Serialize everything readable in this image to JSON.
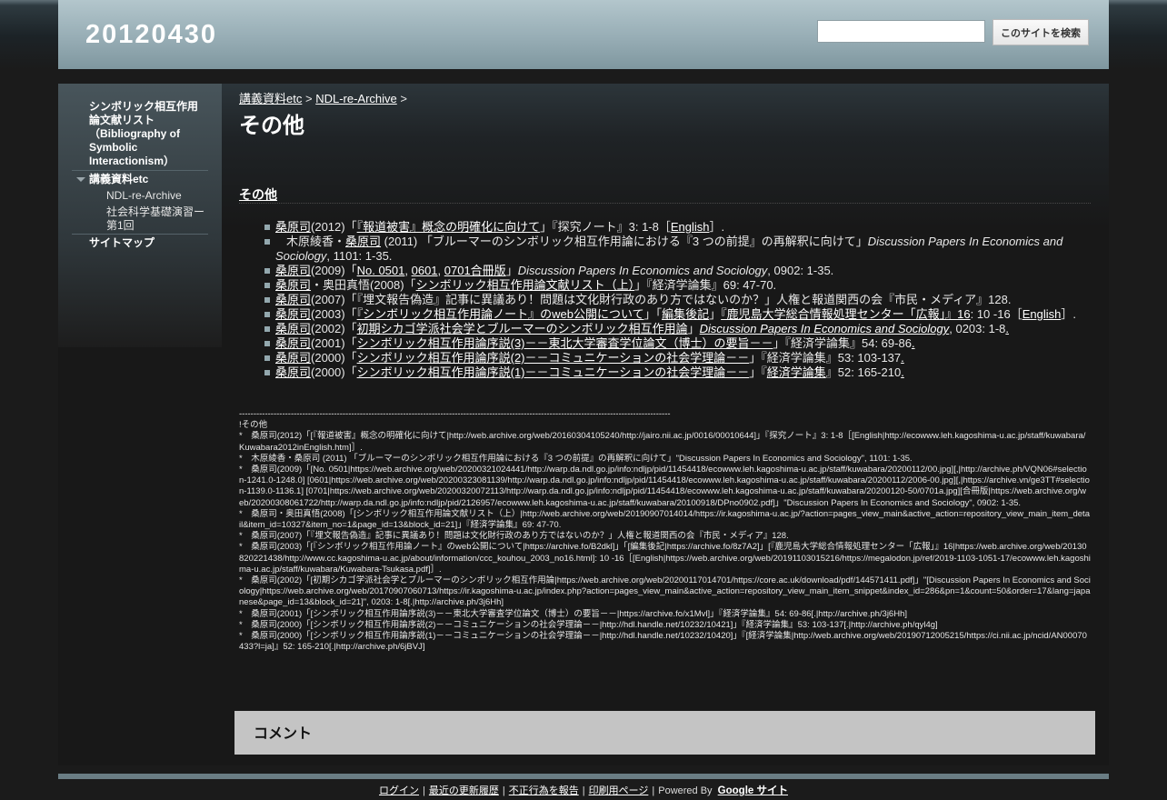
{
  "site": {
    "title": "20120430"
  },
  "search": {
    "placeholder": "",
    "button_label": "このサイトを検索"
  },
  "sidebar": {
    "items": [
      {
        "label": "シンボリック相互作用論文献リスト（Bibliography of Symbolic Interactionism）"
      },
      {
        "label": "講義資料etc",
        "expanded": true,
        "children": [
          {
            "label": "NDL-re-Archive"
          },
          {
            "label": "社会科学基礎演習ー第1回"
          }
        ]
      },
      {
        "label": "サイトマップ"
      }
    ]
  },
  "breadcrumb": {
    "items": [
      "講義資料etc",
      "NDL-re-Archive"
    ],
    "sep": ">"
  },
  "page": {
    "title": "その他",
    "section_heading": "その他"
  },
  "refs": {
    "r1": {
      "a1": "桑原司",
      "t1": "(2012)「",
      "a2": "『報道被害』概念の明確化に向けて",
      "t2": "」『探究ノート』3: 1-8［",
      "a3": "English",
      "t3": "］."
    },
    "r2": {
      "t0": "木原綾香・",
      "a1": "桑原司",
      "t1": " (2011) 「ブルーマーのシンボリック相互作用論における『3 つの前提』の再解釈に向けて」",
      "i1": "Discussion Papers In Economics and Sociology",
      "t2": ", 1101: 1-35."
    },
    "r3": {
      "a1": "桑原司",
      "t1": "(2009)「",
      "a2": "No. 0501",
      "t2": ", ",
      "a3": "0601",
      "t3": ", ",
      "a4": "0701合冊版",
      "t4": "」",
      "i1": "Discussion Papers In Economics and Sociology",
      "t5": ", 0902: 1-35."
    },
    "r4": {
      "a1": "桑原司",
      "t1": "・奥田真悟(2008)「",
      "a2": "シンボリック相互作用論文献リスト（上）",
      "t2": "」『経済学論集』69: 47-70."
    },
    "r5": {
      "a1": "桑原司",
      "t1": "(2007)「『埋文報告偽造』記事に異議あり！問題は文化財行政のあり方ではないのか？」人権と報道関西の会『市民・メディア』128."
    },
    "r6": {
      "a1": "桑原司",
      "t1": "(2003)「",
      "a2": "『シンボリック相互作用論ノート』のweb公開について",
      "t2": "」「",
      "a3": "編集後記",
      "t3": "」",
      "a4": "『鹿児島大学総合情報処理センター「広報」』16",
      "t4": ": 10 -16［",
      "a5": "English",
      "t5": "］."
    },
    "r7": {
      "a1": "桑原司",
      "t1": "(2002)「",
      "a2": "初期シカゴ学派社会学とブルーマーのシンボリック相互作用論",
      "t2": "」",
      "a3": "Discussion Papers In Economics and Sociology",
      "t3": ", 0203: 1-8",
      "a4": "."
    },
    "r8": {
      "a1": "桑原司",
      "t1": "(2001)「",
      "a2": "シンボリック相互作用論序説(3)－－東北大学審査学位論文（博士）の要旨－－",
      "t2": "」『経済学論集』54: 69-86",
      "a3": "."
    },
    "r9": {
      "a1": "桑原司",
      "t1": "(2000)「",
      "a2": "シンボリック相互作用論序説(2)－－コミュニケーションの社会学理論－－",
      "t2": "」『経済学論集』53: 103-137",
      "a3": "."
    },
    "r10": {
      "a1": "桑原司",
      "t1": "(2000)「",
      "a2": "シンボリック相互作用論序説(1)－－コミュニケーションの社会学理論－－",
      "t2": "」『",
      "a3": "経済学論集",
      "t3": "』52: 165-210",
      "a4": "."
    }
  },
  "raw": {
    "divider": "------------------------------------------------------------------------------------------------------------------------------------------------------",
    "lines": [
      "!その他",
      "*　桑原司(2012)「[『報道被害』概念の明確化に向けて|http://web.archive.org/web/20160304105240/http://jairo.nii.ac.jp/0016/00010644]」『探究ノート』3: 1-8［[English|http://ecowww.leh.kagoshima-u.ac.jp/staff/kuwabara/Kuwabara2012inEnglish.htm]］.",
      "*　木原綾香・桑原司 (2011) 「ブルーマーのシンボリック相互作用論における『3 つの前提』の再解釈に向けて」\"Discussion Papers In Economics and Sociology\", 1101: 1-35.",
      "*　桑原司(2009)「[No. 0501|https://web.archive.org/web/20200321024441/http://warp.da.ndl.go.jp/info:ndljp/pid/11454418/ecowww.leh.kagoshima-u.ac.jp/staff/kuwabara/20200112/00.jpg][,|http://archive.ph/VQN06#selection-1241.0-1248.0] [0601|https://web.archive.org/web/20200323081139/http://warp.da.ndl.go.jp/info:ndljp/pid/11454418/ecowww.leh.kagoshima-u.ac.jp/staff/kuwabara/20200112/2006-00.jpg][,|https://archive.vn/ge3TT#selection-1139.0-1136.1] [0701|https://web.archive.org/web/20200320072113/http://warp.da.ndl.go.jp/info:ndljp/pid/11454418/ecowww.leh.kagoshima-u.ac.jp/staff/kuwabara/20200120-50/0701a.jpg][合冊版|https://web.archive.org/web/20200308061722/http://warp.da.ndl.go.jp/info:ndljp/pid/2126957/ecowww.leh.kagoshima-u.ac.jp/staff/kuwabara/20100918/DPno0902.pdf]」\"Discussion Papers In Economics and Sociology\", 0902: 1-35.",
      "*　桑原司・奥田真悟(2008)「[シンボリック相互作用論文献リスト（上）|http://web.archive.org/web/20190907014014/https://ir.kagoshima-u.ac.jp/?action=pages_view_main&active_action=repository_view_main_item_detail&item_id=10327&item_no=1&page_id=13&block_id=21]」『経済学論集』69: 47-70.",
      "*　桑原司(2007)「『埋文報告偽造』記事に異議あり！問題は文化財行政のあり方ではないのか？」人権と報道関西の会『市民・メディア』128.",
      "*　桑原司(2003)「[『シンボリック相互作用論ノート』のweb公開について|https://archive.fo/B2dkl]」「[編集後記|https://archive.fo/8z7A2]」[『鹿児島大学総合情報処理センター「広報」』16|https://web.archive.org/web/20130820221438/http://www.cc.kagoshima-u.ac.jp/about/information/ccc_kouhou_2003_no16.html]: 10 -16［[English|https://web.archive.org/web/20191103015216/https://megalodon.jp/ref/2019-1103-1051-17/ecowww.leh.kagoshima-u.ac.jp/staff/kuwabara/Kuwabara-Tsukasa.pdf]］.",
      "*　桑原司(2002)「[初期シカゴ学派社会学とブルーマーのシンボリック相互作用論|https://web.archive.org/web/20200117014701/https://core.ac.uk/download/pdf/144571411.pdf]」\"[Discussion Papers In Economics and Sociology|https://web.archive.org/web/20170907060713/https://ir.kagoshima-u.ac.jp/index.php?action=pages_view_main&active_action=repository_view_main_item_snippet&index_id=286&pn=1&count=50&order=17&lang=japanese&page_id=13&block_id=21]\", 0203: 1-8[.|http://archive.ph/3j6Hh]",
      "*　桑原司(2001)「[シンボリック相互作用論序説(3)－－東北大学審査学位論文（博士）の要旨－－|https://archive.fo/x1Mvl]」『経済学論集』54: 69-86[.|http://archive.ph/3j6Hh]",
      "*　桑原司(2000)「[シンボリック相互作用論序説(2)－－コミュニケーションの社会学理論－－|http://hdl.handle.net/10232/10421]」『経済学論集』53: 103-137[.|http://archive.ph/qyl4g]",
      "*　桑原司(2000)「[シンボリック相互作用論序説(1)－－コミュニケーションの社会学理論－－|http://hdl.handle.net/10232/10420]」『[経済学論集|http://web.archive.org/web/20190712005215/https://ci.nii.ac.jp/ncid/AN00070433?l=ja]』52: 165-210[.|http://archive.ph/6jBVJ]"
    ]
  },
  "comments": {
    "title": "コメント"
  },
  "footer": {
    "login": "ログイン",
    "recent": "最近の更新履歴",
    "report": "不正行為を報告",
    "print": "印刷用ページ",
    "sep": "|",
    "powered": "Powered By",
    "google_sites": "Google サイト"
  }
}
